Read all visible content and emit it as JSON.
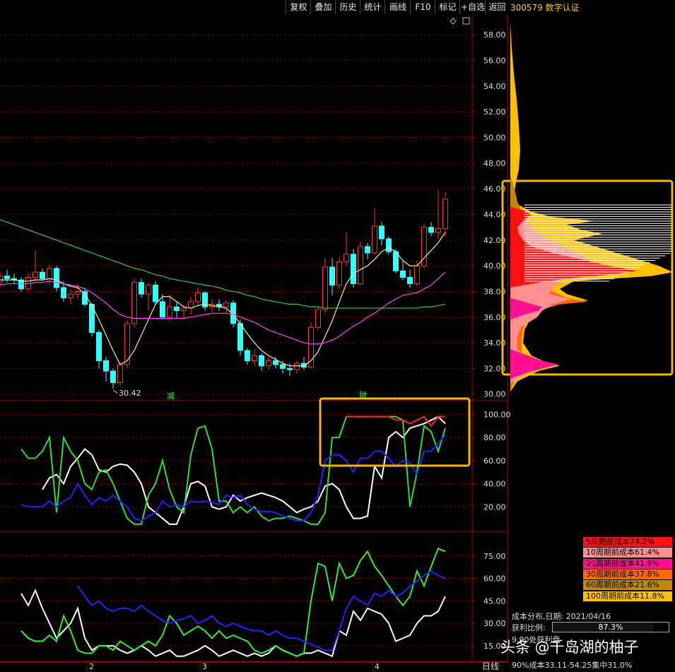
{
  "toolbar": {
    "items": [
      "复权",
      "叠加",
      "历史",
      "统计",
      "画线",
      "F10",
      "标记",
      "+自选",
      "返回"
    ]
  },
  "title": "300579 数字认证",
  "colors": {
    "up": "#ff3333",
    "down": "#33ffff",
    "grid": "#7a0000",
    "highlight": "#f5b700"
  },
  "chart_data": [
    {
      "type": "candlestick",
      "title": "",
      "yticks": [
        30.0,
        32.0,
        34.0,
        36.0,
        38.0,
        40.0,
        42.0,
        44.0,
        46.0,
        48.0,
        50.0,
        52.0,
        54.0,
        56.0,
        58.0
      ],
      "ytick_labels": [
        "30.00",
        "32.00",
        "34.00",
        "36.00",
        "38.00",
        "40.00",
        "42.00",
        "44.00",
        "46.00",
        "48.00",
        "50.00",
        "52.00",
        "54.00",
        "56.00",
        "58.00"
      ],
      "ylim": [
        29.6,
        59.5
      ],
      "low_annotation": "30.42",
      "event_markers": [
        "减",
        "财"
      ],
      "ohlc": [
        [
          39.2,
          39.8,
          38.0,
          38.6
        ],
        [
          38.6,
          39.4,
          38.1,
          38.9
        ],
        [
          38.9,
          39.6,
          38.3,
          38.7
        ],
        [
          38.7,
          39.5,
          38.4,
          39.2
        ],
        [
          39.2,
          39.7,
          38.7,
          39.0
        ],
        [
          39.0,
          39.4,
          38.6,
          38.9
        ],
        [
          38.9,
          39.1,
          38.0,
          38.2
        ],
        [
          38.2,
          39.4,
          38.0,
          39.1
        ],
        [
          39.1,
          41.2,
          38.7,
          39.5
        ],
        [
          39.5,
          39.8,
          38.8,
          39.0
        ],
        [
          39.0,
          40.1,
          38.5,
          39.8
        ],
        [
          39.8,
          40.0,
          38.0,
          38.3
        ],
        [
          38.3,
          38.8,
          37.2,
          37.5
        ],
        [
          37.5,
          38.2,
          37.0,
          37.8
        ],
        [
          37.8,
          38.6,
          37.4,
          38.0
        ],
        [
          38.0,
          38.3,
          36.8,
          37.0
        ],
        [
          37.0,
          37.1,
          34.5,
          34.8
        ],
        [
          34.8,
          35.0,
          32.0,
          32.6
        ],
        [
          32.6,
          32.9,
          31.0,
          31.8
        ],
        [
          31.8,
          32.0,
          30.42,
          30.9
        ],
        [
          30.9,
          32.5,
          30.6,
          32.3
        ],
        [
          32.3,
          35.8,
          32.0,
          35.5
        ],
        [
          35.5,
          39.0,
          35.2,
          38.7
        ],
        [
          38.7,
          39.0,
          37.5,
          37.8
        ],
        [
          37.8,
          38.7,
          36.5,
          38.5
        ],
        [
          38.5,
          38.8,
          37.0,
          37.2
        ],
        [
          37.2,
          37.8,
          35.8,
          36.0
        ],
        [
          36.0,
          37.8,
          35.7,
          36.8
        ],
        [
          36.8,
          37.2,
          35.9,
          36.5
        ],
        [
          36.5,
          37.0,
          35.8,
          36.7
        ],
        [
          36.7,
          37.6,
          36.2,
          37.2
        ],
        [
          37.2,
          38.3,
          36.9,
          37.9
        ],
        [
          37.9,
          38.0,
          36.5,
          36.8
        ],
        [
          36.8,
          37.4,
          36.4,
          37.0
        ],
        [
          37.0,
          37.4,
          36.5,
          36.8
        ],
        [
          36.8,
          37.3,
          36.3,
          37.1
        ],
        [
          37.1,
          37.3,
          35.2,
          35.5
        ],
        [
          35.5,
          35.8,
          33.0,
          33.4
        ],
        [
          33.4,
          33.6,
          32.3,
          32.6
        ],
        [
          32.6,
          33.5,
          32.2,
          33.0
        ],
        [
          33.0,
          33.2,
          31.8,
          32.2
        ],
        [
          32.2,
          32.9,
          31.9,
          32.6
        ],
        [
          32.6,
          32.9,
          32.0,
          32.3
        ],
        [
          32.3,
          32.6,
          31.6,
          32.0
        ],
        [
          32.0,
          32.4,
          31.4,
          31.9
        ],
        [
          31.9,
          32.6,
          31.6,
          32.4
        ],
        [
          32.4,
          32.9,
          31.9,
          32.1
        ],
        [
          32.1,
          35.6,
          32.0,
          35.2
        ],
        [
          35.2,
          36.8,
          35.0,
          36.6
        ],
        [
          36.6,
          40.6,
          36.3,
          39.9
        ],
        [
          39.9,
          40.6,
          37.7,
          38.5
        ],
        [
          38.5,
          40.7,
          38.2,
          40.3
        ],
        [
          40.3,
          42.6,
          40.0,
          40.9
        ],
        [
          40.9,
          41.3,
          38.3,
          38.6
        ],
        [
          38.6,
          41.9,
          38.5,
          41.5
        ],
        [
          41.5,
          41.8,
          40.5,
          41.0
        ],
        [
          41.0,
          44.5,
          40.9,
          43.1
        ],
        [
          43.1,
          43.4,
          41.6,
          42.1
        ],
        [
          42.1,
          42.3,
          40.9,
          41.1
        ],
        [
          41.1,
          41.3,
          39.4,
          39.6
        ],
        [
          39.6,
          40.4,
          38.9,
          39.1
        ],
        [
          39.1,
          39.7,
          38.3,
          38.6
        ],
        [
          38.6,
          40.4,
          38.4,
          40.0
        ],
        [
          40.0,
          43.3,
          39.8,
          43.0
        ],
        [
          43.0,
          43.4,
          42.3,
          42.6
        ],
        [
          42.6,
          45.9,
          42.1,
          42.9
        ],
        [
          42.9,
          45.7,
          42.3,
          45.2
        ]
      ],
      "ma": [
        {
          "color": "#f0f0a0",
          "values": [
            39.3,
            39.1,
            39.0,
            38.9,
            38.9,
            38.9,
            38.8,
            38.8,
            38.9,
            38.9,
            39.0,
            38.9,
            38.6,
            38.4,
            38.3,
            37.8,
            36.9,
            35.8,
            34.6,
            33.4,
            32.3,
            32.6,
            33.4,
            34.6,
            35.8,
            37.0,
            37.6,
            37.6,
            37.2,
            36.8,
            36.7,
            36.9,
            37.0,
            36.9,
            36.8,
            36.7,
            36.2,
            35.5,
            34.7,
            34.0,
            33.4,
            33.0,
            32.7,
            32.4,
            32.2,
            32.2,
            32.2,
            32.6,
            33.3,
            34.5,
            35.7,
            37.2,
            38.6,
            39.4,
            39.7,
            40.0,
            40.5,
            41.1,
            41.4,
            41.1,
            40.4,
            40.0,
            40.0,
            40.6,
            41.2,
            41.8,
            42.6
          ]
        },
        {
          "color": "#ff44ff",
          "values": [
            38.4,
            38.4,
            38.5,
            38.5,
            38.6,
            38.6,
            38.6,
            38.6,
            38.7,
            38.7,
            38.8,
            38.7,
            38.6,
            38.5,
            38.4,
            38.2,
            37.9,
            37.5,
            37.1,
            36.6,
            36.2,
            36.0,
            35.9,
            35.9,
            35.9,
            35.9,
            35.9,
            35.9,
            35.9,
            35.9,
            36.0,
            36.1,
            36.2,
            36.3,
            36.3,
            36.3,
            36.2,
            36.0,
            35.8,
            35.6,
            35.3,
            35.0,
            34.8,
            34.6,
            34.4,
            34.2,
            34.0,
            33.9,
            33.9,
            34.0,
            34.2,
            34.5,
            34.9,
            35.3,
            35.6,
            36.0,
            36.3,
            36.7,
            37.1,
            37.4,
            37.7,
            37.8,
            37.9,
            38.2,
            38.5,
            39.0,
            39.5
          ]
        },
        {
          "color": "#33cc33",
          "values": [
            44.2,
            44.0,
            43.8,
            43.6,
            43.4,
            43.2,
            43.0,
            42.8,
            42.6,
            42.4,
            42.2,
            42.0,
            41.8,
            41.6,
            41.4,
            41.2,
            41.0,
            40.8,
            40.6,
            40.4,
            40.2,
            40.0,
            39.8,
            39.7,
            39.5,
            39.3,
            39.2,
            39.0,
            38.9,
            38.8,
            38.7,
            38.6,
            38.5,
            38.4,
            38.3,
            38.1,
            38.0,
            37.9,
            37.7,
            37.6,
            37.4,
            37.3,
            37.2,
            37.1,
            37.0,
            37.0,
            36.9,
            36.8,
            36.8,
            36.7,
            36.7,
            36.7,
            36.7,
            36.7,
            36.7,
            36.7,
            36.7,
            36.7,
            36.7,
            36.7,
            36.7,
            36.7,
            36.7,
            36.8,
            36.8,
            36.9,
            37.0
          ]
        }
      ]
    },
    {
      "type": "line",
      "title": "",
      "yticks": [
        20,
        40,
        60,
        80,
        100
      ],
      "ytick_labels": [
        "20.00",
        "40.00",
        "60.00",
        "80.00",
        "100.00"
      ],
      "ylim": [
        0,
        110
      ],
      "series": [
        {
          "color": "#ffffff",
          "values": [
            35,
            45,
            48,
            40,
            55,
            62,
            70,
            65,
            52,
            50,
            55,
            57,
            56,
            50,
            40,
            20,
            15,
            10,
            5,
            5,
            20,
            40,
            42,
            38,
            20,
            18,
            20,
            30,
            25,
            28,
            30,
            32,
            30,
            28,
            25,
            20,
            15,
            18,
            20,
            25,
            38,
            40,
            35,
            20,
            10,
            10,
            12,
            55,
            45,
            80,
            85,
            80,
            88,
            90,
            92,
            95,
            98,
            92
          ]
        },
        {
          "color": "#33dd33",
          "values": [
            70,
            62,
            62,
            68,
            80,
            15,
            80,
            68,
            60,
            40,
            35,
            50,
            52,
            40,
            25,
            10,
            5,
            5,
            30,
            40,
            60,
            35,
            20,
            15,
            65,
            88,
            90,
            70,
            25,
            25,
            15,
            20,
            15,
            20,
            12,
            8,
            10,
            10,
            12,
            10,
            8,
            5,
            5,
            15,
            80,
            80,
            98,
            98,
            98,
            98,
            98,
            98,
            98,
            98,
            95,
            20,
            50,
            90,
            85,
            68,
            88
          ]
        },
        {
          "color": "#2222ff",
          "values": [
            22,
            20,
            20,
            20,
            25,
            20,
            25,
            28,
            40,
            30,
            22,
            28,
            25,
            30,
            25,
            20,
            10,
            8,
            12,
            15,
            25,
            20,
            22,
            20,
            25,
            24,
            25,
            24,
            22,
            30,
            28,
            30,
            22,
            18,
            16,
            16,
            15,
            12,
            10,
            8,
            8,
            15,
            30,
            60,
            65,
            65,
            60,
            50,
            62,
            62,
            68,
            68,
            62,
            55,
            60,
            58,
            48,
            68,
            68,
            75,
            82
          ]
        },
        {
          "color": "#ff2222",
          "values": [
            null,
            null,
            null,
            null,
            null,
            null,
            null,
            null,
            null,
            null,
            null,
            null,
            null,
            null,
            null,
            null,
            null,
            null,
            null,
            null,
            null,
            null,
            null,
            null,
            null,
            null,
            null,
            null,
            null,
            null,
            null,
            null,
            null,
            null,
            null,
            null,
            null,
            null,
            null,
            null,
            null,
            null,
            null,
            null,
            null,
            null,
            98,
            98,
            98,
            98,
            98,
            98,
            98,
            95,
            95,
            92,
            95,
            98,
            90,
            98,
            98
          ]
        }
      ]
    },
    {
      "type": "line",
      "title": "",
      "yticks": [
        15,
        30,
        45,
        60,
        75
      ],
      "ytick_labels": [
        "15.00",
        "30.00",
        "45.00",
        "60.00",
        "75.00"
      ],
      "ylim": [
        5,
        90
      ],
      "series": [
        {
          "color": "#ffffff",
          "values": [
            50,
            42,
            52,
            40,
            30,
            20,
            25,
            30,
            40,
            20,
            12,
            15,
            15,
            15,
            12,
            10,
            12,
            15,
            12,
            8,
            10,
            12,
            8,
            8,
            10,
            12,
            15,
            12,
            8,
            10,
            12,
            10,
            8,
            10,
            8,
            10,
            15,
            12,
            10,
            8,
            10,
            10,
            12,
            10,
            8,
            25,
            22,
            38,
            32,
            40,
            38,
            36,
            30,
            18,
            20,
            22,
            30,
            35,
            35,
            38,
            48
          ]
        },
        {
          "color": "#33ee33",
          "values": [
            25,
            20,
            18,
            18,
            22,
            18,
            35,
            25,
            12,
            10,
            10,
            15,
            15,
            12,
            18,
            15,
            12,
            15,
            18,
            15,
            22,
            35,
            30,
            22,
            25,
            28,
            25,
            20,
            25,
            20,
            22,
            20,
            18,
            12,
            10,
            12,
            15,
            12,
            10,
            8,
            10,
            45,
            70,
            68,
            45,
            70,
            60,
            62,
            72,
            78,
            68,
            62,
            55,
            48,
            42,
            48,
            65,
            55,
            68,
            80,
            78
          ]
        },
        {
          "color": "#2222ff",
          "values": [
            55,
            48,
            42,
            45,
            40,
            38,
            40,
            40,
            38,
            42,
            38,
            35,
            32,
            30,
            32,
            33,
            35,
            30,
            32,
            35,
            30,
            28,
            30,
            28,
            26,
            25,
            25,
            22,
            25,
            22,
            20,
            20,
            18,
            16,
            14,
            12,
            12,
            25,
            40,
            48,
            45,
            42,
            50,
            48,
            52,
            48,
            50,
            55,
            58,
            62,
            65,
            62,
            60
          ]
        }
      ]
    },
    {
      "type": "area",
      "title": "成本分布",
      "ylim": [
        29.6,
        59.5
      ],
      "legend": [
        {
          "label": "5周期前成本74.2%",
          "color": "#ff1010"
        },
        {
          "label": "10周期前成本61.4%",
          "color": "#ff9090"
        },
        {
          "label": "20周期前成本41.9%",
          "color": "#ff1090"
        },
        {
          "label": "30周期前成本37.8%",
          "color": "#ff6a00"
        },
        {
          "label": "60周期前成本21.6%",
          "color": "#c08a00"
        },
        {
          "label": "100周期前成本11.8%",
          "color": "#ffc000"
        }
      ],
      "date_label": "成本分布,日期: 2021/04/16",
      "profit_label": "获利比例:",
      "profit_ratio": 0.873,
      "profit_text": "87.3%",
      "avg_cost_label": "9.90处获利盘",
      "concentration": "90%成本33.11-54.25集中31.0%"
    }
  ],
  "x_axis_ticks": [
    "2",
    "3",
    "4"
  ],
  "period_label": "日线",
  "watermark": "头条 @千岛湖的柚子"
}
